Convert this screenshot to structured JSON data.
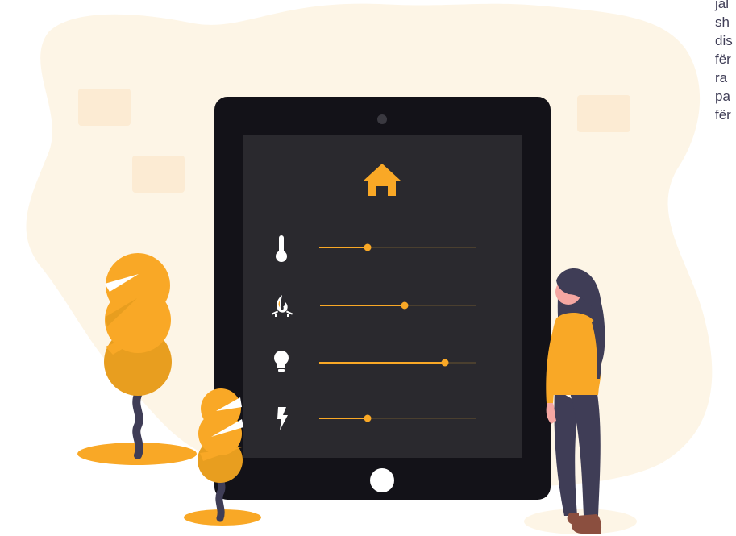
{
  "side_text_lines": [
    "jal",
    "sh",
    "dis",
    "fër",
    "ra",
    "pa",
    "fër"
  ],
  "icons": [
    "home-icon",
    "thermometer-icon",
    "fire-icon",
    "lightbulb-icon",
    "lightning-icon"
  ],
  "sliders": [
    {
      "name": "temperature",
      "icon": "thermometer-icon",
      "level": 0.31
    },
    {
      "name": "heating",
      "icon": "fire-icon",
      "level": 0.54
    },
    {
      "name": "lighting",
      "icon": "lightbulb-icon",
      "level": 0.8
    },
    {
      "name": "power",
      "icon": "lightning-icon",
      "level": 0.31
    }
  ],
  "colors": {
    "accent": "#f9a826",
    "tablet_body": "#131218",
    "tablet_screen": "#2a292e",
    "blob_background": "#fdf5e6",
    "slider_track": "#4a3f2f",
    "tree_trunk": "#3f3d56",
    "leggings": "#3f3d56",
    "skin": "#f5a7a2"
  }
}
